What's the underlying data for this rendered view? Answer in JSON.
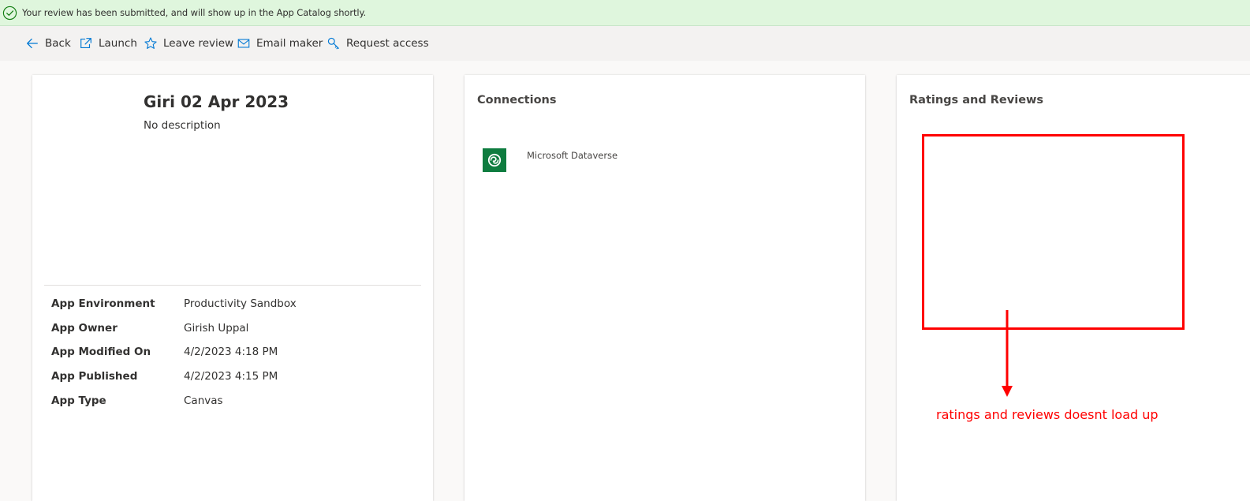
{
  "notification": {
    "text": "Your review has been submitted, and will show up in the App Catalog shortly."
  },
  "commands": [
    {
      "label": "Back",
      "icon": "back-arrow-icon"
    },
    {
      "label": "Launch",
      "icon": "launch-icon"
    },
    {
      "label": "Leave review",
      "icon": "star-icon"
    },
    {
      "label": "Email maker",
      "icon": "mail-icon"
    },
    {
      "label": "Request access",
      "icon": "key-icon"
    }
  ],
  "app": {
    "title": "Giri 02 Apr 2023",
    "description": "No description",
    "properties": [
      {
        "label": "App Environment",
        "value": "Productivity Sandbox"
      },
      {
        "label": "App Owner",
        "value": "Girish Uppal"
      },
      {
        "label": "App Modified On",
        "value": "4/2/2023 4:18 PM"
      },
      {
        "label": "App Published",
        "value": "4/2/2023 4:15 PM"
      },
      {
        "label": "App Type",
        "value": "Canvas"
      }
    ]
  },
  "connections": {
    "title": "Connections",
    "items": [
      {
        "name": "Microsoft Dataverse",
        "icon": "dataverse-icon"
      }
    ]
  },
  "ratings": {
    "title": "Ratings and Reviews",
    "annotation": "ratings and reviews doesnt load up"
  },
  "colors": {
    "success_bg": "#dff6dd",
    "success_icon": "#107c10",
    "command_icon": "#0078d4",
    "dataverse_green": "#0e7c3f",
    "annotation_red": "#ff0000"
  }
}
